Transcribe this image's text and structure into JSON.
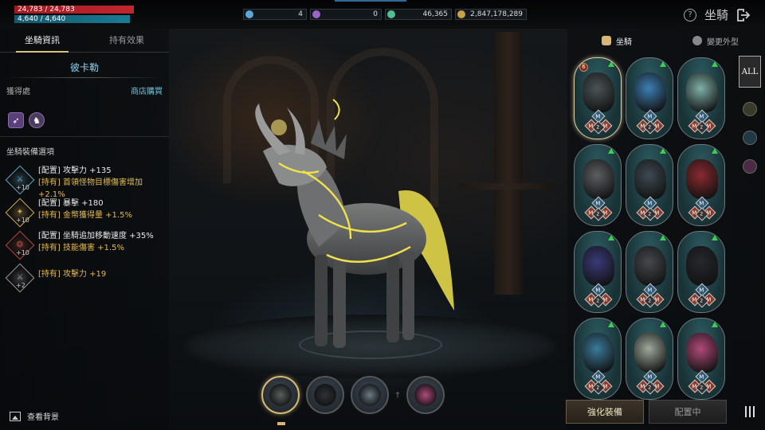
{
  "topbar": {
    "hp": "24,783 / 24,783",
    "mp": "4,640 / 4,640",
    "currencies": [
      {
        "icon": "blue-gem-icon",
        "value": "4",
        "color": "#5aa8d8"
      },
      {
        "icon": "purple-gem-icon",
        "value": "0",
        "color": "#9a63c9"
      },
      {
        "icon": "green-feather-icon",
        "value": "46,365",
        "color": "#4fc18f"
      },
      {
        "icon": "gold-coin-icon",
        "value": "2,847,178,289",
        "color": "#c9a04a"
      }
    ],
    "title": "坐騎",
    "help_icon": "?"
  },
  "left_panel": {
    "tabs": [
      "坐騎資訊",
      "持有效果"
    ],
    "mount_name": "彼卡勒",
    "acquire_label": "獲得處",
    "acquire_value": "商店購買",
    "section_title": "坐騎裝備選項",
    "options": [
      {
        "level": "+10",
        "line1": "[配置] 攻擊力 +135",
        "line2": "[持有] 首領怪物目標傷害增加 +2.1%",
        "color": "#5fa9c9",
        "glyph": "⚔"
      },
      {
        "level": "+10",
        "line1": "[配置] 暴擊 +180",
        "line2": "[持有] 金幣獲得量 +1.5%",
        "color": "#d2ac52",
        "glyph": "✦"
      },
      {
        "level": "+10",
        "line1": "[配置] 坐騎追加移動速度 +35%",
        "line2": "[持有] 技能傷害 +1.5%",
        "color": "#b5493b",
        "glyph": "❂"
      },
      {
        "level": "+2",
        "line1": "",
        "line2": "[持有] 攻擊力 +19",
        "color": "#9a9a9a",
        "glyph": "⚔"
      }
    ],
    "view_background": "查看背景"
  },
  "right_panel": {
    "tabs": [
      "坐騎",
      "變更外型"
    ],
    "filter_all": "ALL",
    "cards": [
      {
        "color": "#4a5456",
        "selected": true,
        "level": "6"
      },
      {
        "color": "#3c7fb4",
        "selected": false,
        "level": ""
      },
      {
        "color": "#7fb0a8",
        "selected": false,
        "level": ""
      },
      {
        "color": "#5c5f62",
        "selected": false,
        "level": ""
      },
      {
        "color": "#3d4a52",
        "selected": false,
        "level": ""
      },
      {
        "color": "#8a2a30",
        "selected": false,
        "level": ""
      },
      {
        "color": "#3a3a7a",
        "selected": false,
        "level": ""
      },
      {
        "color": "#45494e",
        "selected": false,
        "level": ""
      },
      {
        "color": "#26282e",
        "selected": false,
        "level": ""
      },
      {
        "color": "#3a7a9a",
        "selected": false,
        "level": ""
      },
      {
        "color": "#9ea89a",
        "selected": false,
        "level": ""
      },
      {
        "color": "#b04a7a",
        "selected": false,
        "level": ""
      }
    ],
    "badge_top": "M",
    "badge_left": "M",
    "badge_right": "M",
    "badge_center": "2",
    "enhance_button": "強化裝備",
    "equipped_button": "配置中"
  },
  "bottom_mounts": [
    {
      "color": "#5a5e60",
      "active": true
    },
    {
      "color": "#2e3238",
      "active": false
    },
    {
      "color": "#6b7a84",
      "active": false
    },
    {
      "color": "#b04a7a",
      "active": false
    }
  ]
}
